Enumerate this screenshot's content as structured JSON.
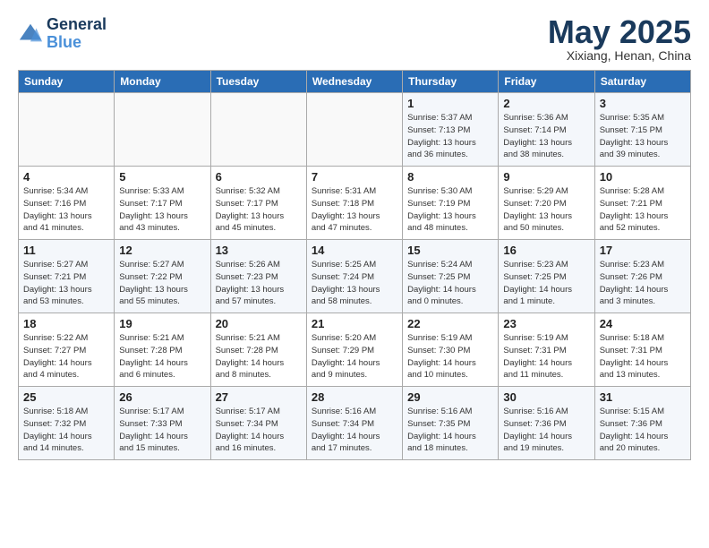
{
  "header": {
    "logo_line1": "General",
    "logo_line2": "Blue",
    "month_title": "May 2025",
    "subtitle": "Xixiang, Henan, China"
  },
  "weekdays": [
    "Sunday",
    "Monday",
    "Tuesday",
    "Wednesday",
    "Thursday",
    "Friday",
    "Saturday"
  ],
  "weeks": [
    [
      {
        "day": "",
        "info": ""
      },
      {
        "day": "",
        "info": ""
      },
      {
        "day": "",
        "info": ""
      },
      {
        "day": "",
        "info": ""
      },
      {
        "day": "1",
        "info": "Sunrise: 5:37 AM\nSunset: 7:13 PM\nDaylight: 13 hours\nand 36 minutes."
      },
      {
        "day": "2",
        "info": "Sunrise: 5:36 AM\nSunset: 7:14 PM\nDaylight: 13 hours\nand 38 minutes."
      },
      {
        "day": "3",
        "info": "Sunrise: 5:35 AM\nSunset: 7:15 PM\nDaylight: 13 hours\nand 39 minutes."
      }
    ],
    [
      {
        "day": "4",
        "info": "Sunrise: 5:34 AM\nSunset: 7:16 PM\nDaylight: 13 hours\nand 41 minutes."
      },
      {
        "day": "5",
        "info": "Sunrise: 5:33 AM\nSunset: 7:17 PM\nDaylight: 13 hours\nand 43 minutes."
      },
      {
        "day": "6",
        "info": "Sunrise: 5:32 AM\nSunset: 7:17 PM\nDaylight: 13 hours\nand 45 minutes."
      },
      {
        "day": "7",
        "info": "Sunrise: 5:31 AM\nSunset: 7:18 PM\nDaylight: 13 hours\nand 47 minutes."
      },
      {
        "day": "8",
        "info": "Sunrise: 5:30 AM\nSunset: 7:19 PM\nDaylight: 13 hours\nand 48 minutes."
      },
      {
        "day": "9",
        "info": "Sunrise: 5:29 AM\nSunset: 7:20 PM\nDaylight: 13 hours\nand 50 minutes."
      },
      {
        "day": "10",
        "info": "Sunrise: 5:28 AM\nSunset: 7:21 PM\nDaylight: 13 hours\nand 52 minutes."
      }
    ],
    [
      {
        "day": "11",
        "info": "Sunrise: 5:27 AM\nSunset: 7:21 PM\nDaylight: 13 hours\nand 53 minutes."
      },
      {
        "day": "12",
        "info": "Sunrise: 5:27 AM\nSunset: 7:22 PM\nDaylight: 13 hours\nand 55 minutes."
      },
      {
        "day": "13",
        "info": "Sunrise: 5:26 AM\nSunset: 7:23 PM\nDaylight: 13 hours\nand 57 minutes."
      },
      {
        "day": "14",
        "info": "Sunrise: 5:25 AM\nSunset: 7:24 PM\nDaylight: 13 hours\nand 58 minutes."
      },
      {
        "day": "15",
        "info": "Sunrise: 5:24 AM\nSunset: 7:25 PM\nDaylight: 14 hours\nand 0 minutes."
      },
      {
        "day": "16",
        "info": "Sunrise: 5:23 AM\nSunset: 7:25 PM\nDaylight: 14 hours\nand 1 minute."
      },
      {
        "day": "17",
        "info": "Sunrise: 5:23 AM\nSunset: 7:26 PM\nDaylight: 14 hours\nand 3 minutes."
      }
    ],
    [
      {
        "day": "18",
        "info": "Sunrise: 5:22 AM\nSunset: 7:27 PM\nDaylight: 14 hours\nand 4 minutes."
      },
      {
        "day": "19",
        "info": "Sunrise: 5:21 AM\nSunset: 7:28 PM\nDaylight: 14 hours\nand 6 minutes."
      },
      {
        "day": "20",
        "info": "Sunrise: 5:21 AM\nSunset: 7:28 PM\nDaylight: 14 hours\nand 8 minutes."
      },
      {
        "day": "21",
        "info": "Sunrise: 5:20 AM\nSunset: 7:29 PM\nDaylight: 14 hours\nand 9 minutes."
      },
      {
        "day": "22",
        "info": "Sunrise: 5:19 AM\nSunset: 7:30 PM\nDaylight: 14 hours\nand 10 minutes."
      },
      {
        "day": "23",
        "info": "Sunrise: 5:19 AM\nSunset: 7:31 PM\nDaylight: 14 hours\nand 11 minutes."
      },
      {
        "day": "24",
        "info": "Sunrise: 5:18 AM\nSunset: 7:31 PM\nDaylight: 14 hours\nand 13 minutes."
      }
    ],
    [
      {
        "day": "25",
        "info": "Sunrise: 5:18 AM\nSunset: 7:32 PM\nDaylight: 14 hours\nand 14 minutes."
      },
      {
        "day": "26",
        "info": "Sunrise: 5:17 AM\nSunset: 7:33 PM\nDaylight: 14 hours\nand 15 minutes."
      },
      {
        "day": "27",
        "info": "Sunrise: 5:17 AM\nSunset: 7:34 PM\nDaylight: 14 hours\nand 16 minutes."
      },
      {
        "day": "28",
        "info": "Sunrise: 5:16 AM\nSunset: 7:34 PM\nDaylight: 14 hours\nand 17 minutes."
      },
      {
        "day": "29",
        "info": "Sunrise: 5:16 AM\nSunset: 7:35 PM\nDaylight: 14 hours\nand 18 minutes."
      },
      {
        "day": "30",
        "info": "Sunrise: 5:16 AM\nSunset: 7:36 PM\nDaylight: 14 hours\nand 19 minutes."
      },
      {
        "day": "31",
        "info": "Sunrise: 5:15 AM\nSunset: 7:36 PM\nDaylight: 14 hours\nand 20 minutes."
      }
    ]
  ]
}
